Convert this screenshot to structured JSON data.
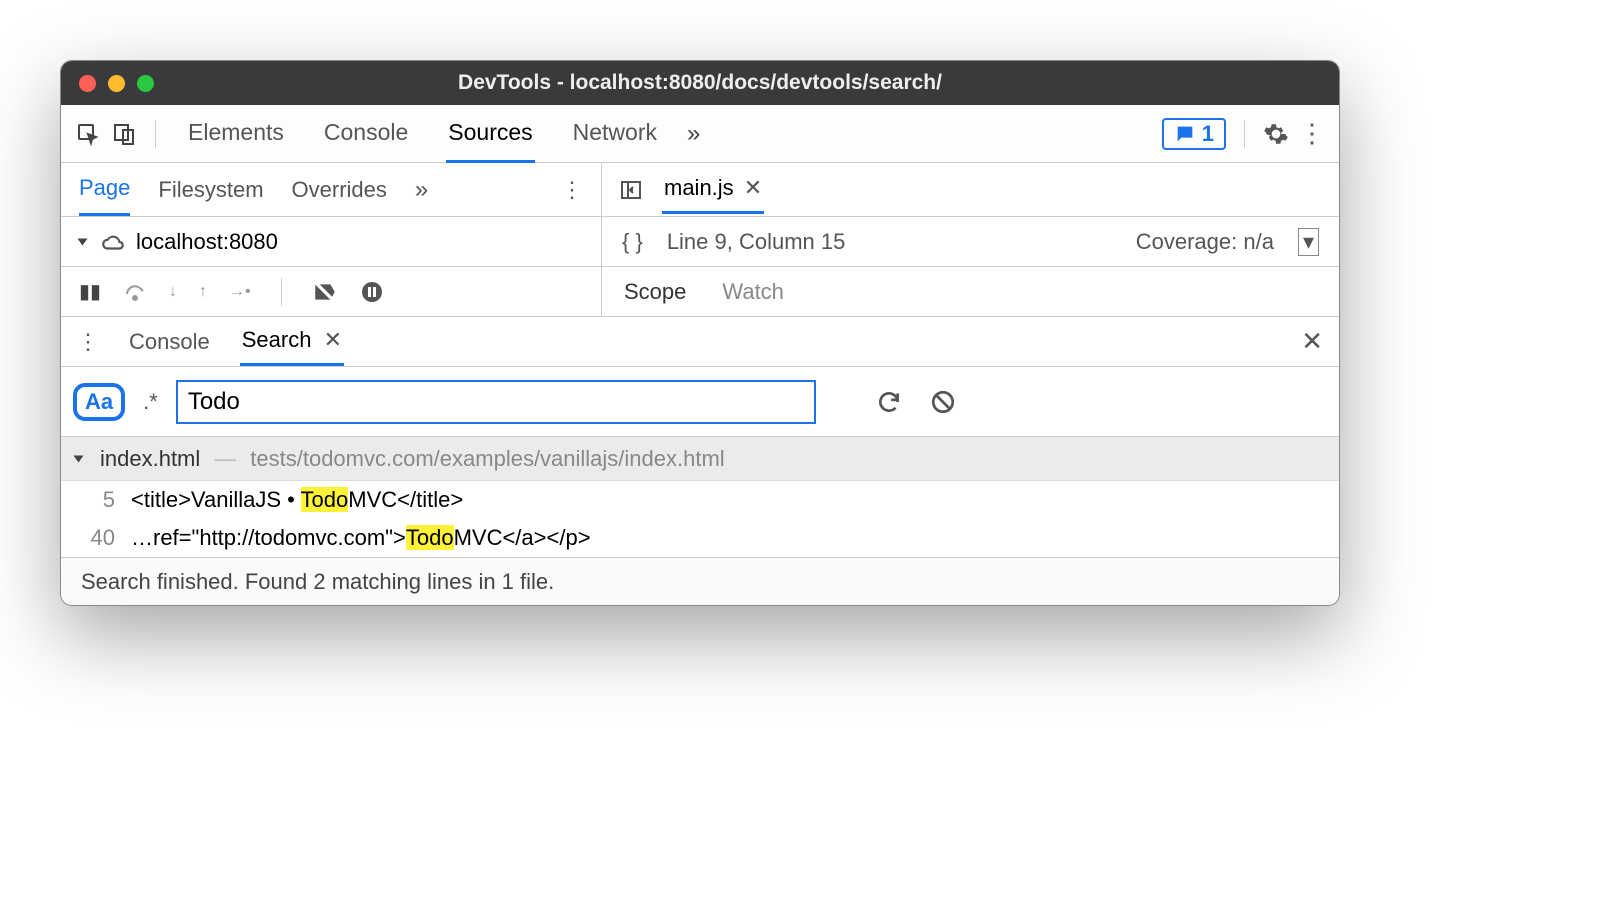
{
  "window": {
    "title": "DevTools - localhost:8080/docs/devtools/search/"
  },
  "tabs": {
    "elements": "Elements",
    "console": "Console",
    "sources": "Sources",
    "network": "Network",
    "more": "»",
    "feedback_count": "1"
  },
  "sources_tabs": {
    "page": "Page",
    "filesystem": "Filesystem",
    "overrides": "Overrides",
    "more": "»"
  },
  "tree": {
    "host": "localhost:8080"
  },
  "editor": {
    "file": "main.js",
    "pos": "Line 9, Column 15",
    "coverage": "Coverage: n/a"
  },
  "dbg_right": {
    "scope": "Scope",
    "watch": "Watch"
  },
  "drawer": {
    "console": "Console",
    "search": "Search"
  },
  "search": {
    "aa": "Aa",
    "regex": ".*",
    "query": "Todo"
  },
  "result": {
    "file": "index.html",
    "path": "tests/todomvc.com/examples/vanillajs/index.html",
    "lines": [
      {
        "n": "5",
        "pre": "<title>VanillaJS • ",
        "hl": "Todo",
        "post": "MVC</title>"
      },
      {
        "n": "40",
        "pre": "…ref=\"http://todomvc.com\">",
        "hl": "Todo",
        "post": "MVC</a></p>"
      }
    ]
  },
  "status": "Search finished.  Found 2 matching lines in 1 file."
}
